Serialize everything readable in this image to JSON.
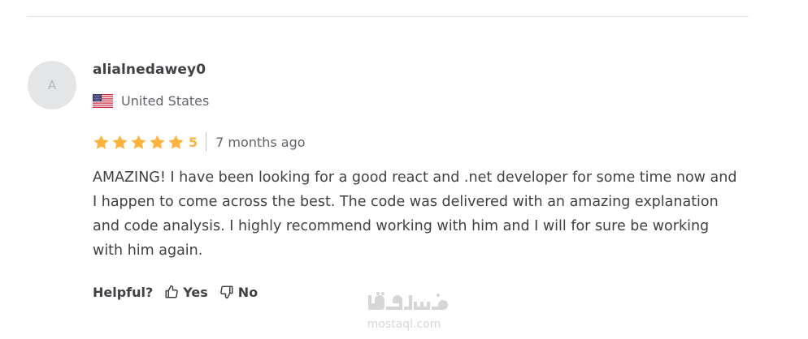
{
  "review": {
    "avatar_initial": "A",
    "username": "alialnedawey0",
    "country": "United States",
    "rating": 5,
    "rating_label": "5",
    "time_ago": "7 months ago",
    "text": "AMAZING! I have been looking for a good react and .net developer for some time now and I happen to come across the best. The code was delivered with an amazing explanation and code analysis. I highly recommend working with him and I will for sure be working with him again."
  },
  "helpful": {
    "label": "Helpful?",
    "yes_label": "Yes",
    "no_label": "No"
  },
  "watermark": {
    "site": "mostaql.com"
  },
  "colors": {
    "star": "#ffb33e",
    "text": "#404145",
    "muted": "#62646a",
    "divider": "#e4e5e7"
  },
  "icons": {
    "flag": "us-flag-icon",
    "star": "star-icon",
    "yes": "thumbs-up-icon",
    "no": "thumbs-down-icon"
  }
}
